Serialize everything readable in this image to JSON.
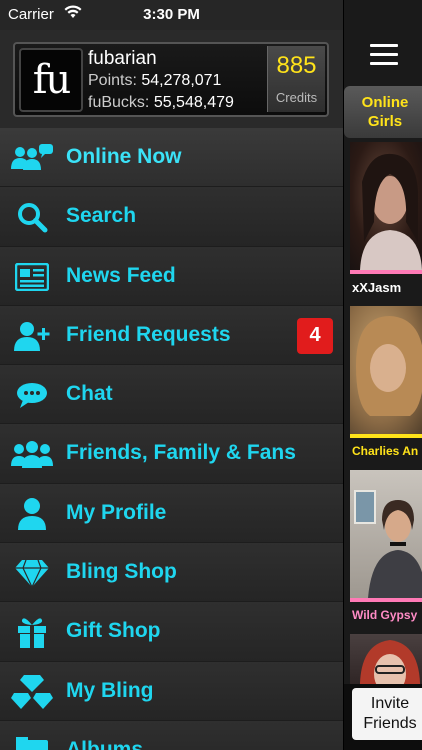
{
  "status": {
    "carrier": "Carrier",
    "time": "3:30 PM"
  },
  "profile": {
    "logo_text": "fu",
    "username": "fubarian",
    "points_label": "Points:",
    "points_value": "54,278,071",
    "fubucks_label": "fuBucks:",
    "fubucks_value": "55,548,479",
    "credits_value": "885",
    "credits_label": "Credits"
  },
  "menu": {
    "items": [
      {
        "label": "Online Now",
        "icon": "online-now-icon"
      },
      {
        "label": "Search",
        "icon": "search-icon"
      },
      {
        "label": "News Feed",
        "icon": "news-feed-icon"
      },
      {
        "label": "Friend Requests",
        "icon": "friend-request-icon",
        "badge": "4"
      },
      {
        "label": "Chat",
        "icon": "chat-icon"
      },
      {
        "label": "Friends, Family & Fans",
        "icon": "friends-icon"
      },
      {
        "label": "My Profile",
        "icon": "profile-icon"
      },
      {
        "label": "Bling Shop",
        "icon": "diamond-icon"
      },
      {
        "label": "Gift Shop",
        "icon": "gift-icon"
      },
      {
        "label": "My Bling",
        "icon": "diamonds-icon"
      },
      {
        "label": "Albums",
        "icon": "albums-icon"
      }
    ]
  },
  "right_panel": {
    "tab_line1": "Online",
    "tab_line2": "Girls",
    "cards": [
      {
        "name": "xXJasm"
      },
      {
        "name": "Charlies An"
      },
      {
        "name": "Wild Gypsy"
      }
    ],
    "invite_line1": "Invite",
    "invite_line2": "Friends"
  },
  "colors": {
    "accent_cyan": "#1fd6ef",
    "credits_yellow": "#ffe31a",
    "badge_red": "#e11c1c",
    "card_bar_pink": "#ff7ab6"
  }
}
